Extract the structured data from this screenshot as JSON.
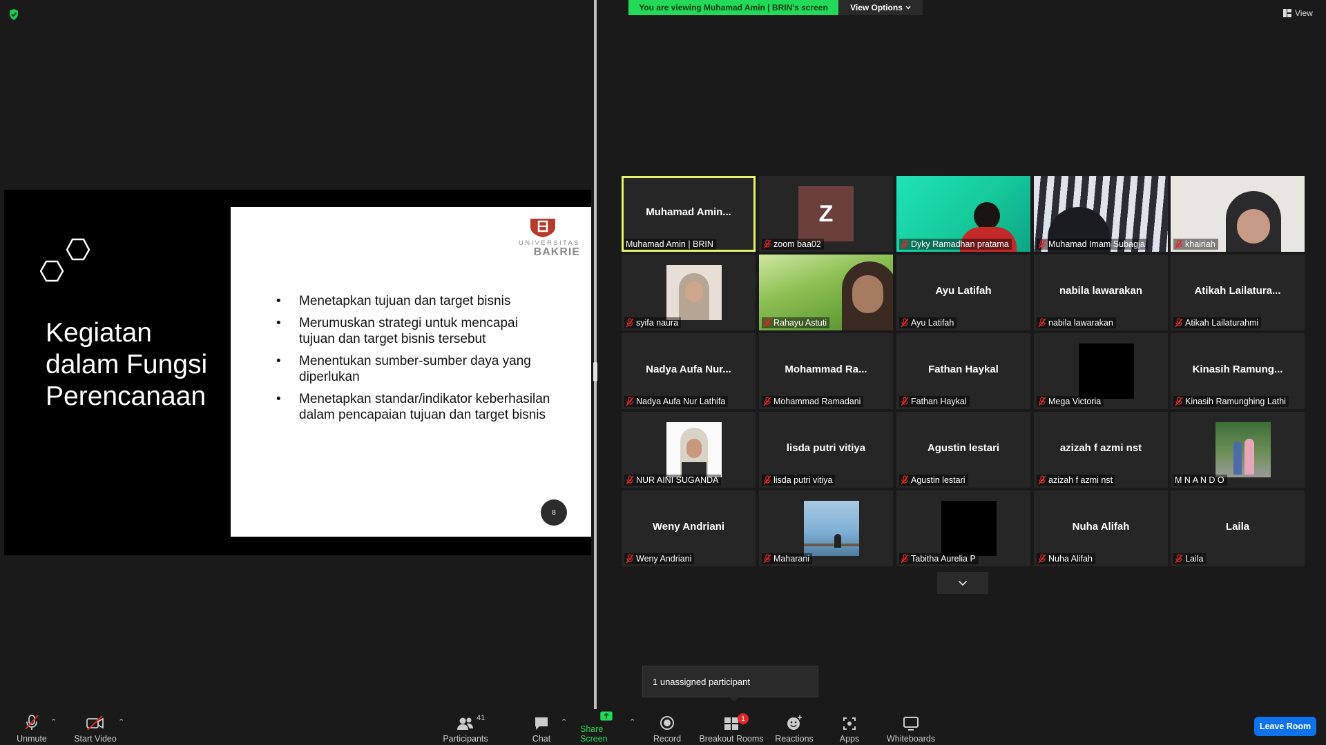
{
  "banner": {
    "viewing_text": "You are viewing Muhamad Amin | BRIN's screen",
    "view_options_label": "View Options"
  },
  "top_right": {
    "view_label": "View"
  },
  "slide": {
    "title_lines": [
      "Kegiatan",
      "dalam Fungsi",
      "Perencanaan"
    ],
    "bullets": [
      "Menetapkan tujuan dan target bisnis",
      "Merumuskan strategi untuk mencapai tujuan dan target bisnis tersebut",
      "Menentukan sumber-sumber daya yang diperlukan",
      "Menetapkan standar/indikator keberhasilan dalam pencapaian tujuan dan target bisnis"
    ],
    "page_number": "8",
    "logo_text": "UNIVERSITAS BAKRIE",
    "logo_parts": [
      "UNIVERSITAS",
      "BAKRIE"
    ]
  },
  "participants": [
    {
      "label": "Muhamad Amin | BRIN",
      "center": "Muhamad  Amin...",
      "muted": false,
      "active": true
    },
    {
      "label": "zoom baa02",
      "avatar": "Z",
      "muted": true
    },
    {
      "label": "Dyky Ramadhan pratama",
      "muted": true,
      "video": "green"
    },
    {
      "label": "Muhamad Imam Subagja",
      "muted": true,
      "video": "stripes"
    },
    {
      "label": "khairiah",
      "muted": true,
      "video": "hijab-light"
    },
    {
      "label": "syifa naura",
      "muted": true,
      "thumb": "portrait"
    },
    {
      "label": "Rahayu Astuti",
      "muted": true,
      "video": "grass"
    },
    {
      "label": "Ayu Latifah",
      "center": "Ayu Latifah",
      "muted": true
    },
    {
      "label": "nabila lawarakan",
      "center": "nabila lawarakan",
      "muted": true
    },
    {
      "label": "Atikah Lailaturahmi",
      "center": "Atikah  Lailatura...",
      "muted": true
    },
    {
      "label": "Nadya Aufa Nur Lathifa",
      "center": "Nadya Aufa Nur...",
      "muted": true
    },
    {
      "label": "Mohammad Ramadani",
      "center": "Mohammad  Ra...",
      "muted": true
    },
    {
      "label": "Fathan Haykal",
      "center": "Fathan Haykal",
      "muted": true
    },
    {
      "label": "Mega Victoria",
      "muted": true,
      "thumb": "black"
    },
    {
      "label": "Kinasih Ramunghing Lathi",
      "center": "Kinasih  Ramung...",
      "muted": true
    },
    {
      "label": "NUR AINI SUGANDA",
      "muted": true,
      "thumb": "hijab-white"
    },
    {
      "label": "lisda putri vitiya",
      "center": "lisda putri vitiya",
      "muted": true
    },
    {
      "label": "Agustin lestari",
      "center": "Agustin lestari",
      "muted": true
    },
    {
      "label": "azizah f azmi nst",
      "center": "azizah f azmi nst",
      "muted": true
    },
    {
      "label": "M N A N D O",
      "muted": false,
      "thumb": "couple"
    },
    {
      "label": "Weny Andriani",
      "center": "Weny Andriani",
      "muted": true
    },
    {
      "label": "Maharani",
      "muted": true,
      "thumb": "sea"
    },
    {
      "label": "Tabitha Aurelia P",
      "muted": true,
      "thumb": "black"
    },
    {
      "label": "Nuha Alifah",
      "center": "Nuha Alifah",
      "muted": true
    },
    {
      "label": "Laila",
      "center": "Laila",
      "muted": true
    }
  ],
  "tooltip": {
    "text": "1 unassigned participant"
  },
  "toolbar": {
    "unmute": "Unmute",
    "start_video": "Start Video",
    "participants": "Participants",
    "participants_count": "41",
    "chat": "Chat",
    "share_screen": "Share Screen",
    "record": "Record",
    "breakout_rooms": "Breakout Rooms",
    "breakout_badge": "1",
    "reactions": "Reactions",
    "apps": "Apps",
    "whiteboards": "Whiteboards",
    "leave": "Leave Room"
  },
  "colors": {
    "share_green": "#23d959",
    "active_border": "#e6f26b",
    "leave_blue": "#0e72ed",
    "mute_red": "#e02828"
  }
}
